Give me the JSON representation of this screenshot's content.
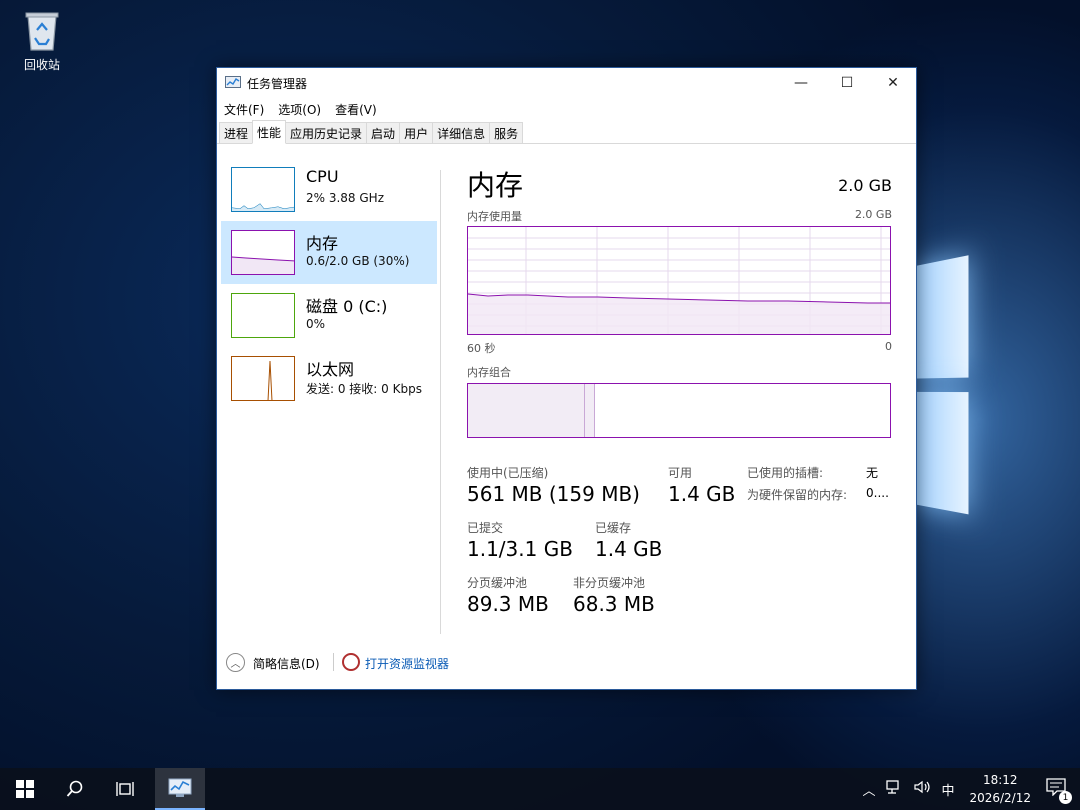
{
  "desktop": {
    "recycle_bin_label": "回收站"
  },
  "window": {
    "title": "任务管理器",
    "controls": {
      "minimize": "—",
      "maximize": "☐",
      "close": "✕"
    }
  },
  "menu": [
    "文件(F)",
    "选项(O)",
    "查看(V)"
  ],
  "tabs": [
    "进程",
    "性能",
    "应用历史记录",
    "启动",
    "用户",
    "详细信息",
    "服务"
  ],
  "active_tab": "性能",
  "sidebar": [
    {
      "name": "CPU",
      "sub": "2%  3.88 GHz",
      "color": "#117dbb"
    },
    {
      "name": "内存",
      "sub": "0.6/2.0 GB (30%)",
      "color": "#8b12ae"
    },
    {
      "name": "磁盘 0 (C:)",
      "sub": "0%",
      "color": "#4da60c"
    },
    {
      "name": "以太网",
      "sub": "发送: 0  接收: 0 Kbps",
      "color": "#a74f01"
    }
  ],
  "memory": {
    "title": "内存",
    "total": "2.0 GB",
    "usage_label": "内存使用量",
    "usage_max": "2.0 GB",
    "axis_left": "60 秒",
    "axis_right": "0",
    "composition_label": "内存组合",
    "stats": {
      "in_use_label": "使用中(已压缩)",
      "in_use_value": "561 MB (159 MB)",
      "available_label": "可用",
      "available_value": "1.4 GB",
      "committed_label": "已提交",
      "committed_value": "1.1/3.1 GB",
      "cached_label": "已缓存",
      "cached_value": "1.4 GB",
      "paged_label": "分页缓冲池",
      "paged_value": "89.3 MB",
      "nonpaged_label": "非分页缓冲池",
      "nonpaged_value": "68.3 MB",
      "slots_label": "已使用的插槽:",
      "slots_value": "无",
      "reserved_label": "为硬件保留的内存:",
      "reserved_value": "0...."
    }
  },
  "footer": {
    "collapse_label": "简略信息(D)",
    "monitor_link": "打开资源监视器"
  },
  "taskbar": {
    "ime": "中",
    "time": "18:12",
    "date": "2026/2/12",
    "notifications": "1"
  }
}
